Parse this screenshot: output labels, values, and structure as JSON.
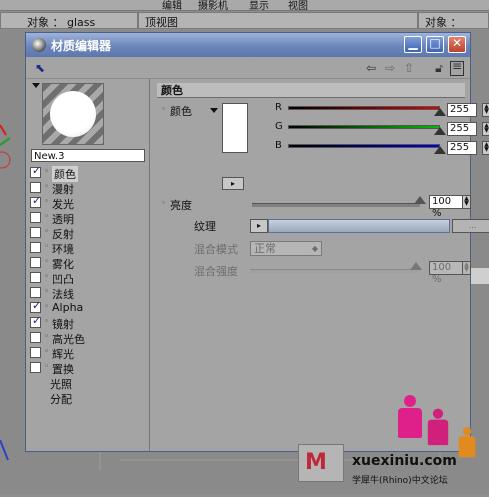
{
  "app": {
    "menubar": [
      "编辑",
      "摄影机",
      "显示",
      "视图"
    ],
    "left_object_label": "对象 ： glass",
    "viewport_title": "顶视图",
    "right_object_label": "对象 ： glass"
  },
  "window": {
    "title": "材质编辑器",
    "buttons": {
      "minimize": "▁",
      "maximize": "□",
      "close": "✕"
    },
    "toolbar": {
      "pick_icon": "cursor-pick-icon",
      "back_icon": "arrow-left-icon",
      "forward_icon": "arrow-right-icon",
      "up_icon": "arrow-up-icon",
      "lock_icon": "lock-icon",
      "layout_icon": "panel-icon"
    }
  },
  "material": {
    "name": "New.3",
    "channels": [
      {
        "label": "颜色",
        "checked": true,
        "has_checkbox": true,
        "active": true
      },
      {
        "label": "漫射",
        "checked": false,
        "has_checkbox": true,
        "active": false
      },
      {
        "label": "发光",
        "checked": true,
        "has_checkbox": true,
        "active": false
      },
      {
        "label": "透明",
        "checked": false,
        "has_checkbox": true,
        "active": false
      },
      {
        "label": "反射",
        "checked": false,
        "has_checkbox": true,
        "active": false
      },
      {
        "label": "环境",
        "checked": false,
        "has_checkbox": true,
        "active": false
      },
      {
        "label": "雾化",
        "checked": false,
        "has_checkbox": true,
        "active": false
      },
      {
        "label": "凹凸",
        "checked": false,
        "has_checkbox": true,
        "active": false
      },
      {
        "label": "法线",
        "checked": false,
        "has_checkbox": true,
        "active": false
      },
      {
        "label": "Alpha",
        "checked": true,
        "has_checkbox": true,
        "active": false
      },
      {
        "label": "镜射",
        "checked": true,
        "has_checkbox": true,
        "active": false
      },
      {
        "label": "高光色",
        "checked": false,
        "has_checkbox": true,
        "active": false
      },
      {
        "label": "辉光",
        "checked": false,
        "has_checkbox": true,
        "active": false
      },
      {
        "label": "置换",
        "checked": false,
        "has_checkbox": true,
        "active": false
      },
      {
        "label": "光照",
        "checked": false,
        "has_checkbox": false,
        "active": false
      },
      {
        "label": "分配",
        "checked": false,
        "has_checkbox": false,
        "active": false
      }
    ]
  },
  "color_panel": {
    "section_title": "颜色",
    "color_label": "颜色",
    "swatch_color": "#ffffff",
    "channels": [
      {
        "letter": "R",
        "value": "255",
        "fraction": 1.0,
        "gradient": "linear-gradient(90deg,#000,#e00000)"
      },
      {
        "letter": "G",
        "value": "255",
        "fraction": 1.0,
        "gradient": "linear-gradient(90deg,#000,#00c000)"
      },
      {
        "letter": "B",
        "value": "255",
        "fraction": 1.0,
        "gradient": "linear-gradient(90deg,#000,#0000e0)"
      }
    ],
    "brightness_label": "亮度",
    "brightness_value": "100 %",
    "brightness_fraction": 1.0,
    "texture_label": "纹理",
    "texture_more": "...",
    "mix_mode_label": "混合模式",
    "mix_mode_value": "正常",
    "mix_strength_label": "混合强度",
    "mix_strength_value": "100 %"
  },
  "watermark": {
    "site": "xuexiniu.com",
    "subtitle": "学犀牛(Rhino)中文论坛"
  }
}
